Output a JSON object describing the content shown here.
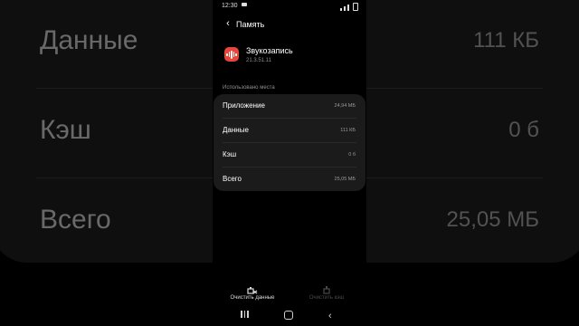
{
  "status_bar": {
    "time": "12:30"
  },
  "header": {
    "title": "Память",
    "back_icon": "chevron-left-icon"
  },
  "app": {
    "name": "Звукозапись",
    "version": "21.3.51.11",
    "icon": "sound-wave-icon",
    "icon_color": "#e8463a"
  },
  "storage": {
    "section_label": "Использовано места",
    "rows": [
      {
        "label": "Приложение",
        "value": "24,94 МБ"
      },
      {
        "label": "Данные",
        "value": "111 КБ"
      },
      {
        "label": "Кэш",
        "value": "0 б"
      },
      {
        "label": "Всего",
        "value": "25,05 МБ"
      }
    ]
  },
  "actions": {
    "clear_data": "Очистить данные",
    "clear_cache": "Очистить кэш"
  },
  "background": {
    "rows": [
      {
        "label": "Данные",
        "value": "111 КБ"
      },
      {
        "label": "Кэш",
        "value": "0 б"
      },
      {
        "label": "Всего",
        "value": "25,05 МБ"
      }
    ]
  }
}
